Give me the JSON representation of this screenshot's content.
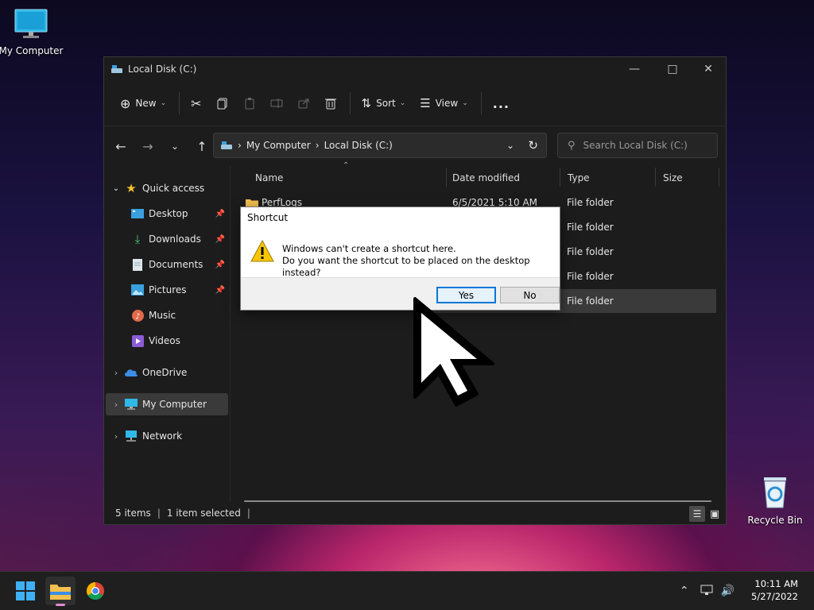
{
  "desktop": {
    "icons": [
      {
        "label": "My Computer"
      },
      {
        "label": "Recycle Bin"
      }
    ]
  },
  "explorer": {
    "title": "Local Disk (C:)",
    "toolbar": {
      "new_label": "New",
      "sort_label": "Sort",
      "view_label": "View",
      "more_label": "..."
    },
    "address": {
      "crumbs": [
        "My Computer",
        "Local Disk (C:)"
      ]
    },
    "search": {
      "placeholder": "Search Local Disk (C:)"
    },
    "sidebar": {
      "quick_access": "Quick access",
      "items": [
        {
          "label": "Desktop",
          "pinned": true
        },
        {
          "label": "Downloads",
          "pinned": true
        },
        {
          "label": "Documents",
          "pinned": true
        },
        {
          "label": "Pictures",
          "pinned": true
        },
        {
          "label": "Music",
          "pinned": false
        },
        {
          "label": "Videos",
          "pinned": false
        }
      ],
      "onedrive": "OneDrive",
      "my_computer": "My Computer",
      "network": "Network"
    },
    "columns": {
      "name": "Name",
      "date": "Date modified",
      "type": "Type",
      "size": "Size"
    },
    "rows": [
      {
        "name": "PerfLogs",
        "date": "6/5/2021 5:10 AM",
        "type": "File folder"
      },
      {
        "name": "",
        "date": "",
        "type": "File folder"
      },
      {
        "name": "",
        "date": "",
        "type": "File folder"
      },
      {
        "name": "",
        "date": "",
        "type": "File folder"
      },
      {
        "name": "",
        "date": "",
        "type": "File folder",
        "selected": true
      }
    ],
    "status": {
      "items": "5 items",
      "selected": "1 item selected"
    }
  },
  "dialog": {
    "title": "Shortcut",
    "line1": "Windows can't create a shortcut here.",
    "line2": "Do you want the shortcut to be placed on the desktop instead?",
    "yes": "Yes",
    "no": "No"
  },
  "taskbar": {
    "time": "10:11 AM",
    "date": "5/27/2022"
  },
  "colors": {
    "accent": "#0078d7",
    "folder": "#f4c04e",
    "warning": "#f7c600"
  }
}
